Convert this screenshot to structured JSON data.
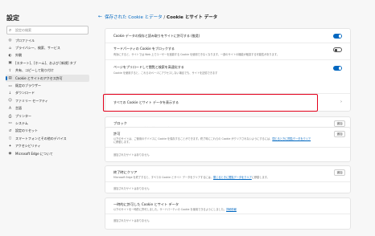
{
  "sidebar": {
    "title": "設定",
    "search_placeholder": "設定の検索",
    "items": [
      {
        "icon": "profile-icon",
        "glyph": "◎",
        "label": "プロファイル"
      },
      {
        "icon": "lock-icon",
        "glyph": "⌂",
        "label": "プライバシー、検索、サービス"
      },
      {
        "icon": "appearance-icon",
        "glyph": "◐",
        "label": "外観"
      },
      {
        "icon": "start-page-icon",
        "glyph": "▣",
        "label": "[スタート]、[ホーム]、および [新規] タブ"
      },
      {
        "icon": "share-icon",
        "glyph": "⇪",
        "label": "共有、コピーして貼り付け"
      },
      {
        "icon": "cookies-icon",
        "glyph": "▤",
        "label": "Cookie とサイトのアクセス許可"
      },
      {
        "icon": "default-browser-icon",
        "glyph": "▭",
        "label": "既定のブラウザー"
      },
      {
        "icon": "download-icon",
        "glyph": "↓",
        "label": "ダウンロード"
      },
      {
        "icon": "family-icon",
        "glyph": "☺",
        "label": "ファミリー セーフティ"
      },
      {
        "icon": "language-icon",
        "glyph": "A",
        "label": "言語"
      },
      {
        "icon": "printer-icon",
        "glyph": "⎙",
        "label": "プリンター"
      },
      {
        "icon": "system-icon",
        "glyph": "▭",
        "label": "システム"
      },
      {
        "icon": "reset-icon",
        "glyph": "↺",
        "label": "設定のリセット"
      },
      {
        "icon": "phone-icon",
        "glyph": "▯",
        "label": "スマートフォンとその他のデバイス"
      },
      {
        "icon": "accessibility-icon",
        "glyph": "✦",
        "label": "アクセシビリティ"
      },
      {
        "icon": "edge-icon",
        "glyph": "◉",
        "label": "Microsoft Edge について"
      }
    ],
    "active_index": 5
  },
  "header": {
    "back_glyph": "←",
    "crumb_link": "保存された Cookie とデータ",
    "crumb_sep": " / ",
    "crumb_current": "Cookie とサイト データ"
  },
  "settings": {
    "row1": {
      "title": "Cookie データの保存と読み取りをサイトに許可する (推奨)",
      "toggle": "on"
    },
    "row2": {
      "title": "サードパーティの Cookie をブロックする",
      "sub": "有効にすると、サイトでは Web 上でユーザーを追跡する Cookie を使用できなくなります。一部のサイトの機能が破損する可能性があります。",
      "toggle": "off"
    },
    "row3": {
      "title": "ページをプリロードして閲覧と検索を高速化する",
      "sub": "Cookie を使用すると、これらのページにアクセスしない場合でも、サイトを記憶できます",
      "toggle": "on"
    },
    "row4": {
      "title": "すべての Cookie とサイト データを表示する",
      "chevron": "›"
    }
  },
  "sections": {
    "block": {
      "title": "ブロック",
      "desc": "以下のサイトに Cookie の保存と読み取りを禁止しています。",
      "add": "追加",
      "empty": "追加されたサイトはありません"
    },
    "allow": {
      "title": "許可",
      "desc": "以下のサイトは、ご使用のデバイスに Cookie を保存することができます。終了時にこれらの Cookie がクリアされないようにするには、",
      "link": "閉じるときに閲覧データをクリア",
      "desc2": "に移動します。",
      "add": "追加",
      "empty": "追加されたサイトはありません"
    },
    "exit": {
      "title": "終了時にクリア",
      "desc": "Microsoft Edge を終了すると、すべての Cookie とサイト データをクリアするには、",
      "link": "閉じるときに閲覧データをクリア",
      "desc2": "に移動します。",
      "add": "追加",
      "empty": "追加されたサイトはありません"
    },
    "temp": {
      "title": "一時的に許可した Cookie とサイト データ",
      "desc": "以下のサイトを一時的に許可しました。サードパーティの Cookie を使用できるようにしました。",
      "link": "詳細情報",
      "empty": "追加されたサイトはありません"
    }
  }
}
